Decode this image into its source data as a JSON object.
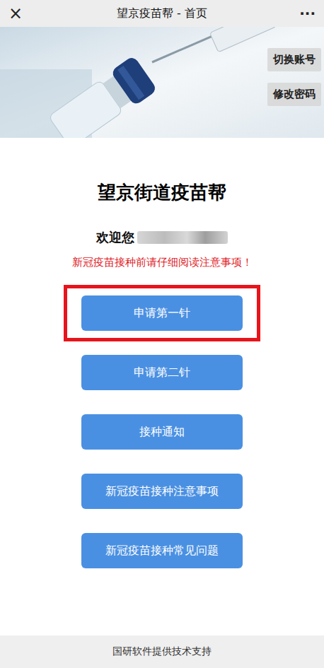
{
  "topbar": {
    "close": "×",
    "title": "望京疫苗帮 - 首页",
    "more": "···"
  },
  "banner": {
    "actions": [
      "切换账号",
      "修改密码"
    ]
  },
  "heading": "望京街道疫苗帮",
  "welcome": "欢迎您",
  "notice": "新冠疫苗接种前请仔细阅读注意事项！",
  "menu": [
    {
      "label": "申请第一针",
      "highlighted": true
    },
    {
      "label": "申请第二针",
      "highlighted": false
    },
    {
      "label": "接种通知",
      "highlighted": false
    },
    {
      "label": "新冠疫苗接种注意事项",
      "highlighted": false
    },
    {
      "label": "新冠疫苗接种常见问题",
      "highlighted": false
    }
  ],
  "footer": "国研软件提供技术支持"
}
